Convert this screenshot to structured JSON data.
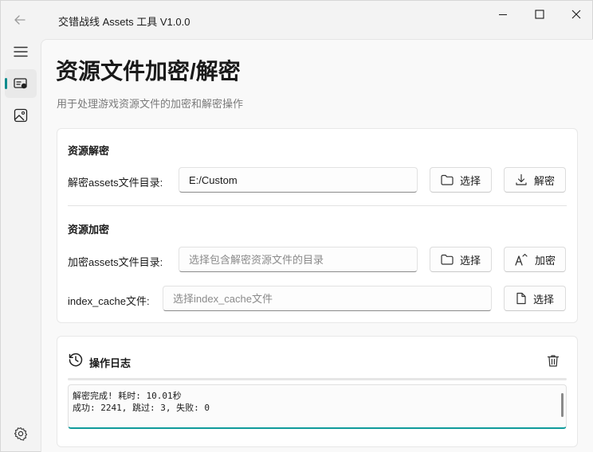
{
  "window": {
    "title": "交错战线 Assets 工具 V1.0.0"
  },
  "nav": {
    "items": [
      {
        "icon": "hamburger-menu-icon"
      },
      {
        "icon": "id-card-icon",
        "active": true
      },
      {
        "icon": "image-icon"
      }
    ],
    "footer_icon": "settings-gear-icon"
  },
  "page": {
    "title": "资源文件加密/解密",
    "subtitle": "用于处理游戏资源文件的加密和解密操作"
  },
  "decrypt": {
    "section_title": "资源解密",
    "dir_label": "解密assets文件目录:",
    "dir_value": "E:/Custom",
    "select_label": "选择",
    "action_label": "解密"
  },
  "encrypt": {
    "section_title": "资源加密",
    "dir_label": "加密assets文件目录:",
    "dir_placeholder": "选择包含解密资源文件的目录",
    "dir_value": "",
    "select_label": "选择",
    "action_label": "加密",
    "cache_label": "index_cache文件:",
    "cache_placeholder": "选择index_cache文件",
    "cache_value": "",
    "cache_select_label": "选择"
  },
  "log": {
    "title": "操作日志",
    "lines": [
      "解密完成! 耗时: 10.01秒",
      "成功: 2241, 跳过: 3, 失败: 0"
    ]
  },
  "colors": {
    "accent": "#0f9b9b",
    "background": "#f3f3f3",
    "card": "#ffffff"
  }
}
